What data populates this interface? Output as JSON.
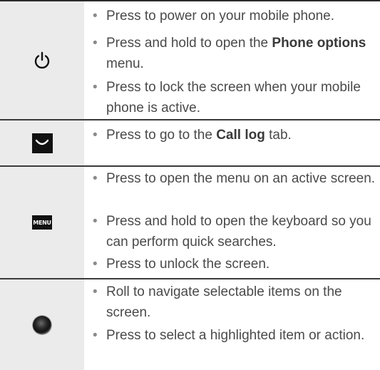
{
  "rows": [
    {
      "icon": "power-icon",
      "items": [
        {
          "text": "Press to power on your mobile phone."
        },
        {
          "before": "Press and hold to open the ",
          "bold": "Phone options",
          "after": " menu."
        },
        {
          "text": "Press to lock the screen when your mobile phone is active."
        }
      ]
    },
    {
      "icon": "call-log-key-icon",
      "items": [
        {
          "before": "Press to go to the ",
          "bold": "Call log",
          "after": " tab."
        }
      ]
    },
    {
      "icon": "menu-key-icon",
      "icon_label": "MENU",
      "items": [
        {
          "text": "Press to open the menu on an active screen."
        },
        {
          "text": "Press and hold to open the keyboard so you can perform quick searches."
        },
        {
          "text": "Press to unlock the screen."
        }
      ]
    },
    {
      "icon": "trackball-icon",
      "items": [
        {
          "text": "Roll to navigate selectable items on the screen."
        },
        {
          "text": "Press to select a highlighted item or action."
        }
      ]
    }
  ],
  "bullet_char": "•",
  "colors": {
    "icon_cell_bg": "#ebebeb",
    "text": "#4a4a4a",
    "rule": "#2b2b2b"
  }
}
